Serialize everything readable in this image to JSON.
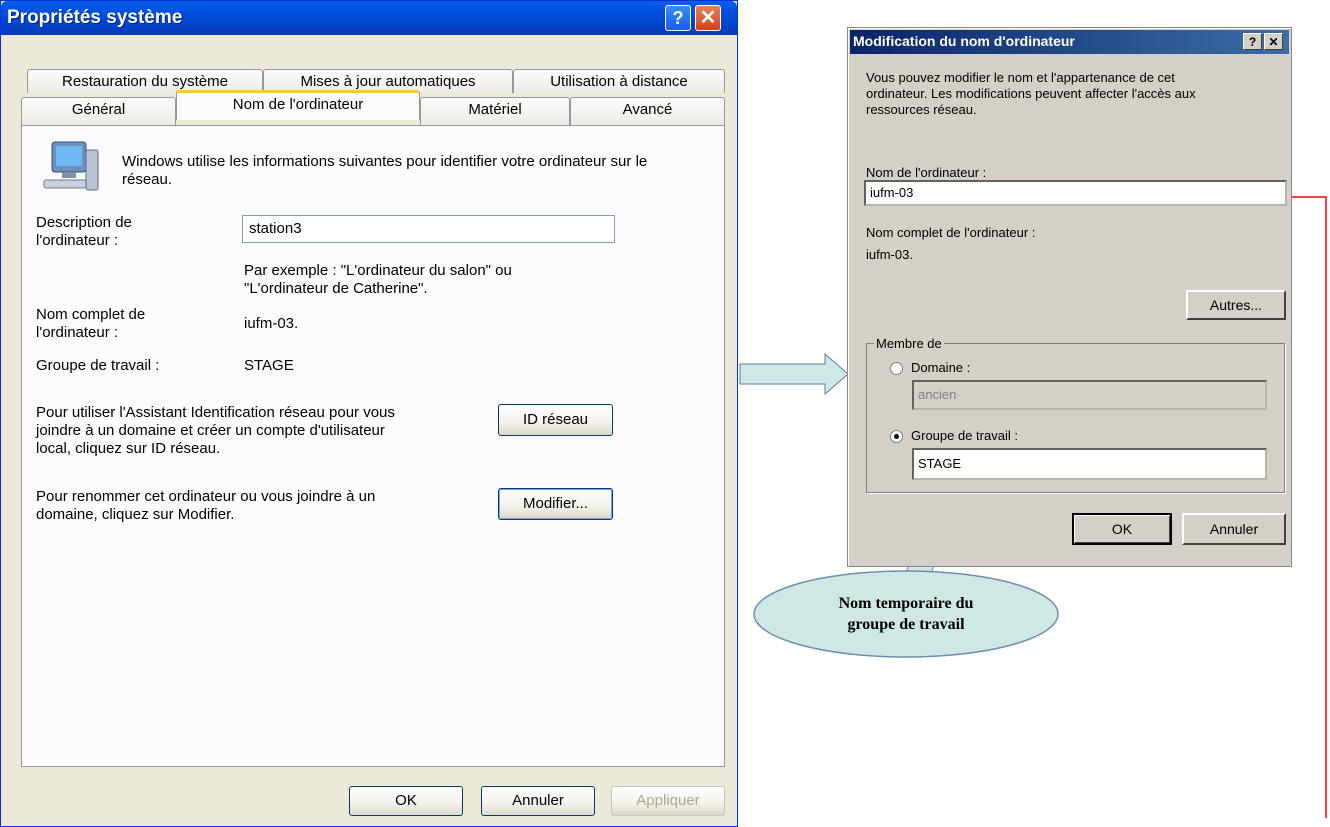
{
  "system_props": {
    "title": "Propriétés système",
    "tabs_back": [
      "Restauration du système",
      "Mises à jour automatiques",
      "Utilisation à distance"
    ],
    "tabs_front": [
      "Général",
      "Nom de l'ordinateur",
      "Matériel",
      "Avancé"
    ],
    "intro": "Windows utilise les informations suivantes pour identifier votre ordinateur sur le réseau.",
    "description_label_1": "Description de",
    "description_label_2": "l'ordinateur :",
    "description_value": "station3",
    "example_1": "Par exemple : \"L'ordinateur du salon\" ou",
    "example_2": "\"L'ordinateur de Catherine\".",
    "fullname_label_1": "Nom complet de",
    "fullname_label_2": "l'ordinateur :",
    "fullname_value": "iufm-03.",
    "workgroup_label": "Groupe de travail :",
    "workgroup_value": "STAGE",
    "netid_text_1": "Pour utiliser l'Assistant Identification réseau pour vous",
    "netid_text_2": "joindre à un domaine et créer un compte d'utilisateur",
    "netid_text_3": "local, cliquez sur ID réseau.",
    "netid_button": "ID réseau",
    "rename_text_1": "Pour renommer cet ordinateur ou vous joindre à un",
    "rename_text_2": "domaine, cliquez sur Modifier.",
    "modify_button": "Modifier...",
    "ok": "OK",
    "cancel": "Annuler",
    "apply": "Appliquer"
  },
  "change_name": {
    "title": "Modification du nom d'ordinateur",
    "intro_1": "Vous pouvez modifier le nom et l'appartenance de cet",
    "intro_2": "ordinateur. Les modifications peuvent affecter l'accès aux",
    "intro_3": "ressources réseau.",
    "name_label": "Nom de l'ordinateur :",
    "name_value": "iufm-03",
    "fullname_label": "Nom complet de l'ordinateur :",
    "fullname_value": "iufm-03.",
    "more_button": "Autres...",
    "member_of": "Membre de",
    "domain_label": "Domaine :",
    "domain_value": "ancien",
    "workgroup_label": "Groupe de travail :",
    "workgroup_value": "STAGE",
    "selected_membership": "workgroup",
    "ok": "OK",
    "cancel": "Annuler"
  },
  "annotation": {
    "callout_1": "Nom temporaire du",
    "callout_2": "groupe de travail"
  },
  "colors": {
    "xp_title": "#0055e5",
    "arrow_fill": "#cfe7e5",
    "callout_fill": "#cfe7e5",
    "red_line": "#ff0000"
  }
}
